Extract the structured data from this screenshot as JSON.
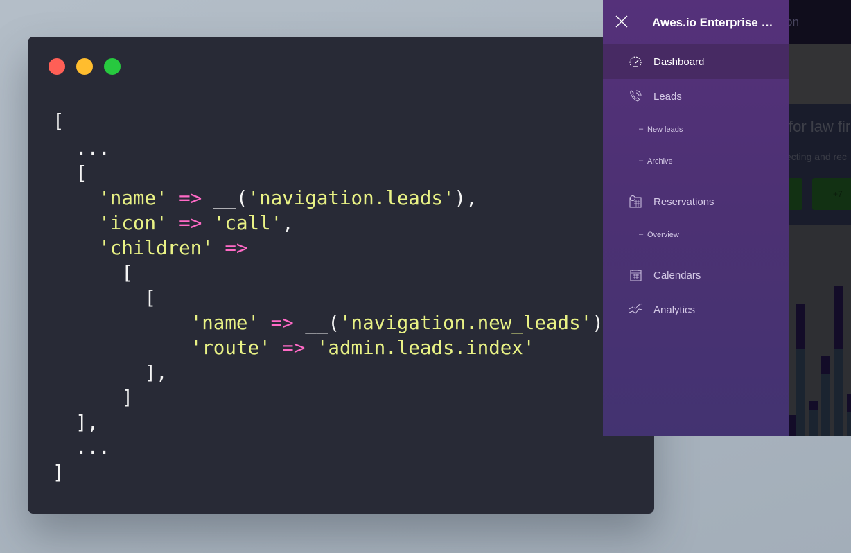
{
  "code_window": {
    "traffic_lights": {
      "close": "#ff5f56",
      "minimize": "#ffbd2e",
      "maximize": "#27c93f"
    },
    "lines": [
      [
        {
          "t": "p",
          "v": "["
        }
      ],
      [
        {
          "t": "p",
          "v": "  ..."
        }
      ],
      [
        {
          "t": "p",
          "v": "  ["
        }
      ],
      [
        {
          "t": "p",
          "v": "    "
        },
        {
          "t": "s",
          "v": "'name'"
        },
        {
          "t": "p",
          "v": " "
        },
        {
          "t": "o",
          "v": "=>"
        },
        {
          "t": "p",
          "v": " __("
        },
        {
          "t": "s",
          "v": "'navigation.leads'"
        },
        {
          "t": "p",
          "v": "),"
        }
      ],
      [
        {
          "t": "p",
          "v": "    "
        },
        {
          "t": "s",
          "v": "'icon'"
        },
        {
          "t": "p",
          "v": " "
        },
        {
          "t": "o",
          "v": "=>"
        },
        {
          "t": "p",
          "v": " "
        },
        {
          "t": "s",
          "v": "'call'"
        },
        {
          "t": "p",
          "v": ","
        }
      ],
      [
        {
          "t": "p",
          "v": "    "
        },
        {
          "t": "s",
          "v": "'children'"
        },
        {
          "t": "p",
          "v": " "
        },
        {
          "t": "o",
          "v": "=>"
        }
      ],
      [
        {
          "t": "p",
          "v": "      ["
        }
      ],
      [
        {
          "t": "p",
          "v": "        ["
        }
      ],
      [
        {
          "t": "p",
          "v": "            "
        },
        {
          "t": "s",
          "v": "'name'"
        },
        {
          "t": "p",
          "v": " "
        },
        {
          "t": "o",
          "v": "=>"
        },
        {
          "t": "p",
          "v": " __("
        },
        {
          "t": "s",
          "v": "'navigation.new_leads'"
        },
        {
          "t": "p",
          "v": "),"
        }
      ],
      [
        {
          "t": "p",
          "v": "            "
        },
        {
          "t": "s",
          "v": "'route'"
        },
        {
          "t": "p",
          "v": " "
        },
        {
          "t": "o",
          "v": "=>"
        },
        {
          "t": "p",
          "v": " "
        },
        {
          "t": "s",
          "v": "'admin.leads.index'"
        }
      ],
      [
        {
          "t": "p",
          "v": "        ],"
        }
      ],
      [
        {
          "t": "p",
          "v": "      ]"
        }
      ],
      [
        {
          "t": "p",
          "v": "  ],"
        }
      ],
      [
        {
          "t": "p",
          "v": "  ..."
        }
      ],
      [
        {
          "t": "p",
          "v": "]"
        }
      ]
    ]
  },
  "sidebar": {
    "title": "Awes.io Enterprise Edition",
    "close_icon": "close-icon",
    "items": [
      {
        "label": "Dashboard",
        "icon": "speedometer-icon",
        "active": true
      },
      {
        "label": "Leads",
        "icon": "phone-call-icon",
        "children": [
          "New leads",
          "Archive"
        ]
      },
      {
        "label": "Reservations",
        "icon": "calendar-clock-icon",
        "children": [
          "Overview"
        ]
      },
      {
        "label": "Calendars",
        "icon": "calendar-icon"
      },
      {
        "label": "Analytics",
        "icon": "trend-lines-icon"
      }
    ]
  },
  "background_app": {
    "header_fragment": "on",
    "hero_title_fragment": "for law fir",
    "hero_subtitle_fragment": "ecting and rec",
    "button_fragment": "+7"
  }
}
